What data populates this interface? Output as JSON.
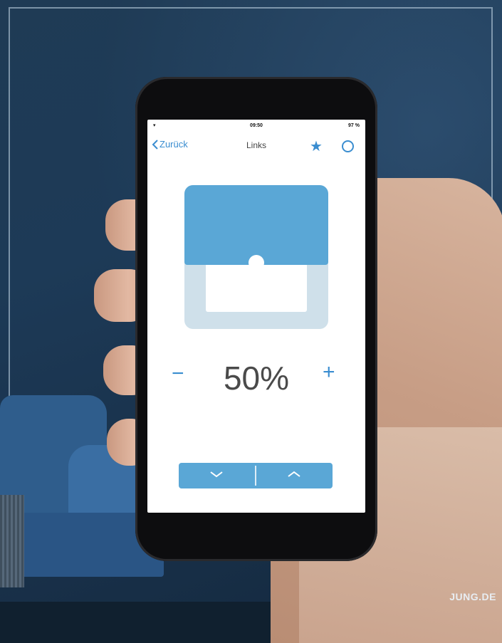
{
  "status_bar": {
    "time": "09:50",
    "battery": "97 %"
  },
  "nav": {
    "back_label": "Zurück",
    "title": "Links"
  },
  "blind": {
    "level_percent": 50
  },
  "control": {
    "minus": "−",
    "value": "50%",
    "plus": "+"
  },
  "icons": {
    "back": "chevron-left-icon",
    "favorite": "star-icon",
    "settings": "ring-icon",
    "down": "chevron-down-icon",
    "up": "chevron-up-icon"
  },
  "colors": {
    "accent": "#3a8dd0",
    "blind": "#5aa7d6",
    "frame": "#cfe0ea"
  },
  "brand": "JUNG.DE"
}
